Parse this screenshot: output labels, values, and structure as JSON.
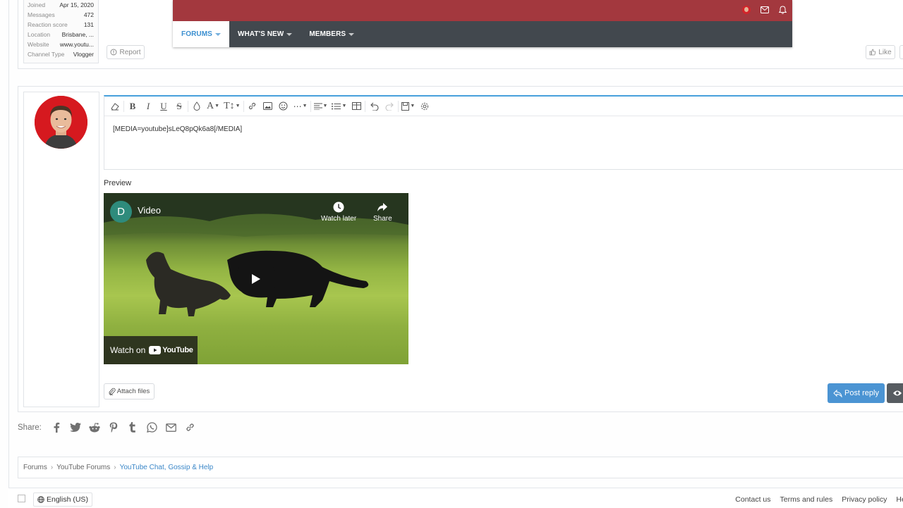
{
  "prev_post": {
    "user_extras": [
      {
        "key": "Joined",
        "value": "Apr 15, 2020"
      },
      {
        "key": "Messages",
        "value": "472"
      },
      {
        "key": "Reaction score",
        "value": "131"
      },
      {
        "key": "Location",
        "value": "Brisbane, ..."
      },
      {
        "key": "Website",
        "value": "www.youtu..."
      },
      {
        "key": "Channel Type",
        "value": "Vlogger"
      }
    ],
    "report_label": "Report",
    "like_label": "Like"
  },
  "navbar": {
    "tabs": [
      {
        "label": "FORUMS",
        "active": true
      },
      {
        "label": "WHAT'S NEW",
        "active": false
      },
      {
        "label": "MEMBERS",
        "active": false
      }
    ],
    "color_top": "#a3383e",
    "color_bottom": "#42484e"
  },
  "editor": {
    "content": "[MEDIA=youtube]sLeQ8pQk6a8[/MEDIA]"
  },
  "preview": {
    "label": "Preview",
    "video_title": "Video",
    "channel_initial": "D",
    "watch_later": "Watch later",
    "share": "Share",
    "watch_on": "Watch on",
    "youtube": "YouTube"
  },
  "actions": {
    "attach_files": "Attach files",
    "post_reply": "Post reply",
    "accent": "#4b94d3"
  },
  "share": {
    "label": "Share:",
    "icons": [
      "facebook-icon",
      "twitter-icon",
      "reddit-icon",
      "pinterest-icon",
      "tumblr-icon",
      "whatsapp-icon",
      "email-icon",
      "link-icon"
    ]
  },
  "breadcrumbs": [
    "Forums",
    "YouTube Forums",
    "YouTube Chat, Gossip & Help"
  ],
  "footer": {
    "language": "English (US)",
    "links": [
      "Contact us",
      "Terms and rules",
      "Privacy policy",
      "Help"
    ]
  }
}
